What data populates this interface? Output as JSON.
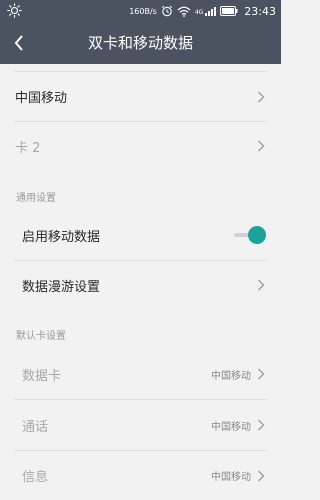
{
  "status_bar": {
    "network_speed": "160B/s",
    "network_type": "4G",
    "time": "23:43",
    "icons": [
      "brightness-icon",
      "alarm-icon",
      "wifi-icon",
      "signal-icon",
      "battery-icon"
    ]
  },
  "header": {
    "title": "双卡和移动数据"
  },
  "sim_cards": [
    {
      "label": "中国移动"
    },
    {
      "label": "卡 2"
    }
  ],
  "general": {
    "heading": "通用设置",
    "mobile_data_label": "启用移动数据",
    "mobile_data_enabled": true,
    "roaming_label": "数据漫游设置"
  },
  "default_card": {
    "heading": "默认卡设置",
    "items": [
      {
        "label": "数据卡",
        "value": "中国移动"
      },
      {
        "label": "通话",
        "value": "中国移动"
      },
      {
        "label": "信息",
        "value": "中国移动"
      }
    ]
  },
  "colors": {
    "header_bg": "#4b5360",
    "toggle_on": "#1aa39a",
    "background": "#f2f2f2"
  }
}
